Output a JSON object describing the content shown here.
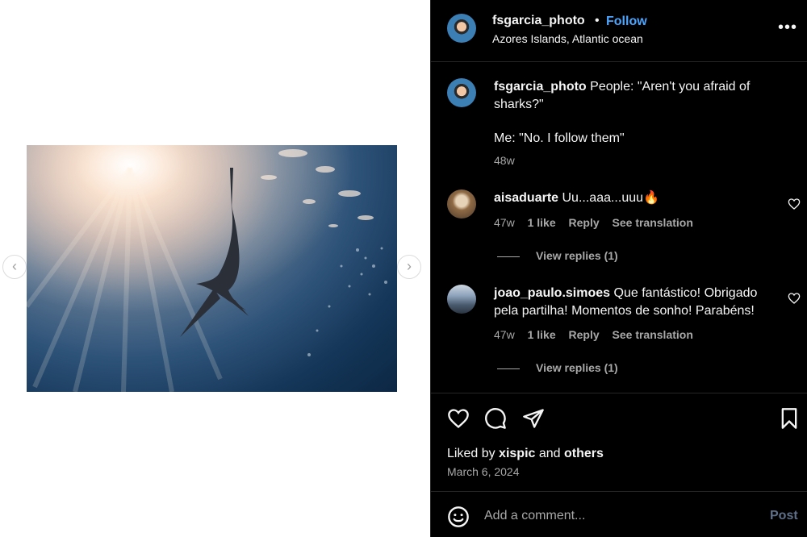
{
  "post": {
    "username": "fsgarcia_photo",
    "separator": "•",
    "follow_label": "Follow",
    "location": "Azores Islands, Atlantic ocean",
    "more_label": "•••"
  },
  "media": {
    "prev_label": "‹",
    "next_label": "›"
  },
  "caption": {
    "username": "fsgarcia_photo",
    "line1": "People: \"Aren't you afraid of sharks?\"",
    "line2": "Me: \"No. I follow them\"",
    "age": "48w"
  },
  "comments": [
    {
      "username": "aisaduarte",
      "text": "Uu...aaa...uuu🔥",
      "age": "47w",
      "likes": "1 like",
      "reply": "Reply",
      "translate": "See translation",
      "view_replies": "View replies (1)"
    },
    {
      "username": "joao_paulo.simoes",
      "text": "Que fantástico! Obrigado pela partilha! Momentos de sonho! Parabéns!",
      "age": "47w",
      "likes": "1 like",
      "reply": "Reply",
      "translate": "See translation",
      "view_replies": "View replies (1)"
    }
  ],
  "likes": {
    "prefix": "Liked by",
    "user": "xispic",
    "and": "and",
    "others": "others"
  },
  "date": "March 6, 2024",
  "comment_box": {
    "placeholder": "Add a comment...",
    "post_label": "Post"
  },
  "colors": {
    "accent": "#4aa6ff",
    "panel_bg": "#000000",
    "muted_text": "#a8a8a8"
  }
}
